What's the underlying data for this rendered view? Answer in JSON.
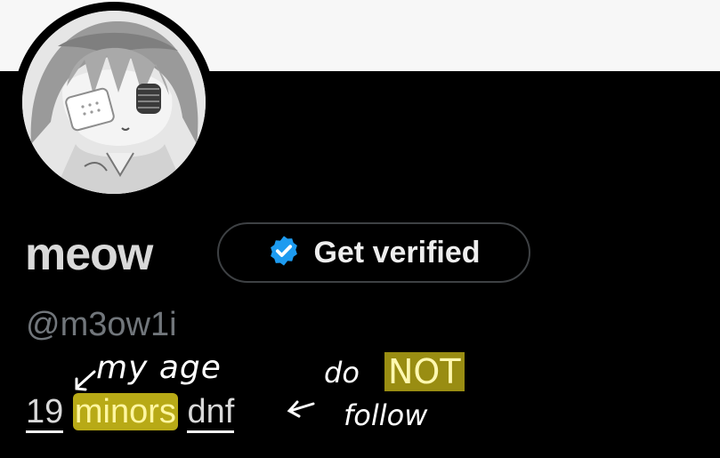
{
  "profile": {
    "display_name": "meow",
    "handle": "@m3ow1i",
    "verify_button_label": "Get verified",
    "verify_icon": "verified-badge-icon",
    "accent_color": "#1d9bf0",
    "bio": {
      "age": "19",
      "minors": "minors",
      "dnf": "dnf"
    }
  },
  "annotations": {
    "age_note": "my age",
    "do": "do",
    "not": "NOT",
    "follow": "follow",
    "highlight_color": "#ffeb1e"
  }
}
